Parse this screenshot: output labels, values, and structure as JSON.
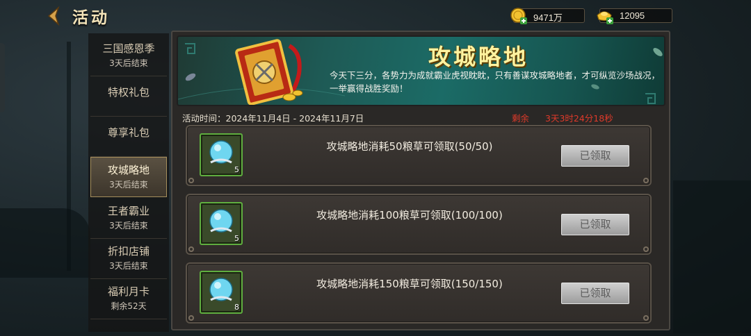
{
  "header": {
    "title": "活动",
    "back_icon": "chevron-left-icon",
    "currencies": [
      {
        "icon": "gold-coin-icon",
        "value": "9471万"
      },
      {
        "icon": "gold-ingot-icon",
        "value": "12095"
      }
    ]
  },
  "sidebar": {
    "items": [
      {
        "name": "三国感恩季",
        "status": "3天后结束"
      },
      {
        "name": "特权礼包",
        "status": ""
      },
      {
        "name": "尊享礼包",
        "status": ""
      },
      {
        "name": "攻城略地",
        "status": "3天后结束",
        "active": true
      },
      {
        "name": "王者霸业",
        "status": "3天后结束"
      },
      {
        "name": "折扣店铺",
        "status": "3天后结束"
      },
      {
        "name": "福利月卡",
        "status": "剩余52天"
      }
    ]
  },
  "banner": {
    "title": "攻城略地",
    "description": "今天下三分，各势力为成就霸业虎视眈眈，只有善谋攻城略地者，才可纵览沙场战况，一举赢得战胜奖励！",
    "art_icon": "war-book-icon"
  },
  "activity": {
    "time_label": "活动时间：2024年11月4日 - 2024年11月7日",
    "remaining_label": "剩余",
    "remaining_value": "3天3时24分18秒"
  },
  "tasks": [
    {
      "desc": "攻城略地消耗50粮草可领取(50/50)",
      "reward_icon": "crystal-orb-icon",
      "reward_qty": "5",
      "button": "已领取"
    },
    {
      "desc": "攻城略地消耗100粮草可领取(100/100)",
      "reward_icon": "crystal-orb-icon",
      "reward_qty": "5",
      "button": "已领取"
    },
    {
      "desc": "攻城略地消耗150粮草可领取(150/150)",
      "reward_icon": "crystal-orb-icon",
      "reward_qty": "8",
      "button": "已领取"
    }
  ],
  "colors": {
    "accent_gold": "#f3e3b8",
    "countdown_red": "#e03a2a",
    "item_border_green": "#5fae3f",
    "claimed_button_grey": "#b4b4b4"
  }
}
